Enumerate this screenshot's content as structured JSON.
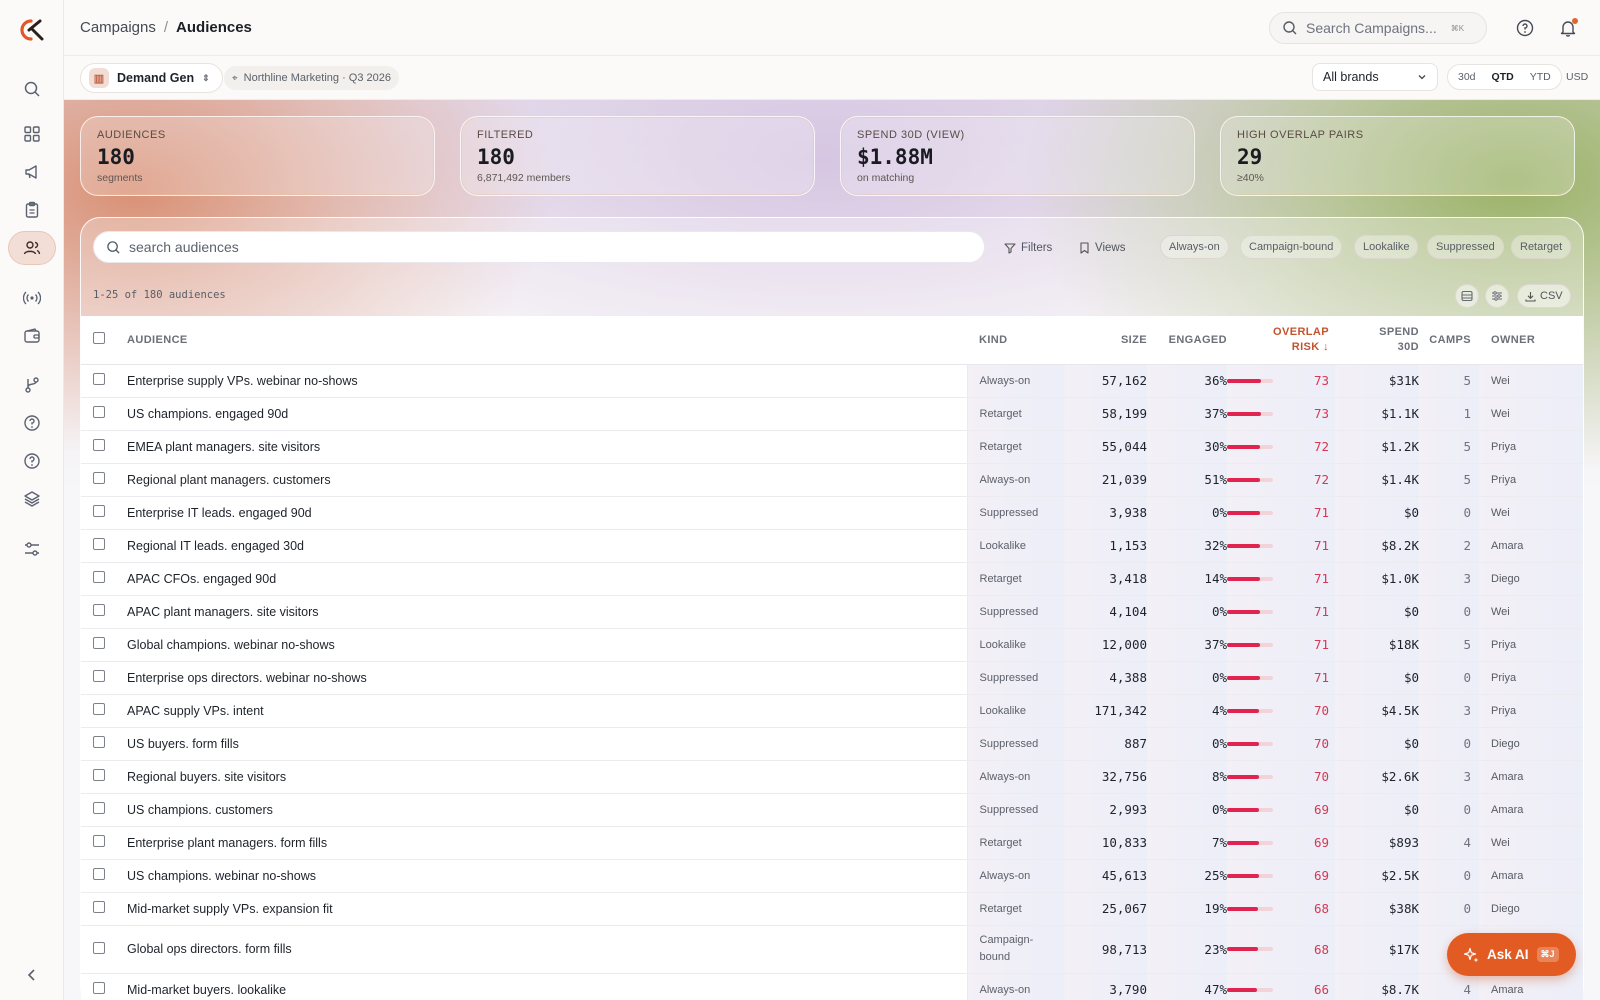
{
  "breadcrumb": {
    "parent": "Campaigns",
    "separator": "/",
    "current": "Audiences"
  },
  "top_search": {
    "placeholder": "Search Campaigns...",
    "shortcut": "⌘K"
  },
  "workspace": {
    "name": "Demand Gen",
    "context": "Northline Marketing · Q3 2026"
  },
  "brand_filter": {
    "value": "All brands"
  },
  "ranges": [
    "30d",
    "QTD",
    "YTD"
  ],
  "active_range": "QTD",
  "currency": "USD",
  "stats": [
    {
      "label": "Audiences",
      "value": "180",
      "sub": "segments"
    },
    {
      "label": "Filtered",
      "value": "180",
      "sub": "6,871,492 members"
    },
    {
      "label": "Spend 30D (view)",
      "value": "$1.88M",
      "sub": "on matching"
    },
    {
      "label": "High overlap pairs",
      "value": "29",
      "sub": "≥40%"
    }
  ],
  "table_search": {
    "placeholder": "search audiences"
  },
  "toolbar": {
    "filters": "Filters",
    "views": "Views",
    "csv": "CSV"
  },
  "kind_chips": [
    "Always-on",
    "Campaign-bound",
    "Lookalike",
    "Suppressed",
    "Retarget"
  ],
  "count_text": "1-25 of 180 audiences",
  "columns": {
    "audience": "Audience",
    "kind": "Kind",
    "size": "Size",
    "engaged": "Engaged",
    "overlap_risk_1": "Overlap",
    "overlap_risk_2": "Risk",
    "spend_1": "Spend",
    "spend_2": "30D",
    "camps": "Camps",
    "owner": "Owner"
  },
  "rows": [
    {
      "name": "Enterprise supply VPs. webinar no-shows",
      "kind": "Always-on",
      "size": "57,162",
      "engaged": "36%",
      "risk": 73,
      "spend": "$31K",
      "camps": "5",
      "owner": "Wei"
    },
    {
      "name": "US champions. engaged 90d",
      "kind": "Retarget",
      "size": "58,199",
      "engaged": "37%",
      "risk": 73,
      "spend": "$1.1K",
      "camps": "1",
      "owner": "Wei"
    },
    {
      "name": "EMEA plant managers. site visitors",
      "kind": "Retarget",
      "size": "55,044",
      "engaged": "30%",
      "risk": 72,
      "spend": "$1.2K",
      "camps": "5",
      "owner": "Priya"
    },
    {
      "name": "Regional plant managers. customers",
      "kind": "Always-on",
      "size": "21,039",
      "engaged": "51%",
      "risk": 72,
      "spend": "$1.4K",
      "camps": "5",
      "owner": "Priya"
    },
    {
      "name": "Enterprise IT leads. engaged 90d",
      "kind": "Suppressed",
      "size": "3,938",
      "engaged": "0%",
      "risk": 71,
      "spend": "$0",
      "camps": "0",
      "owner": "Wei"
    },
    {
      "name": "Regional IT leads. engaged 30d",
      "kind": "Lookalike",
      "size": "1,153",
      "engaged": "32%",
      "risk": 71,
      "spend": "$8.2K",
      "camps": "2",
      "owner": "Amara"
    },
    {
      "name": "APAC CFOs. engaged 90d",
      "kind": "Retarget",
      "size": "3,418",
      "engaged": "14%",
      "risk": 71,
      "spend": "$1.0K",
      "camps": "3",
      "owner": "Diego"
    },
    {
      "name": "APAC plant managers. site visitors",
      "kind": "Suppressed",
      "size": "4,104",
      "engaged": "0%",
      "risk": 71,
      "spend": "$0",
      "camps": "0",
      "owner": "Wei"
    },
    {
      "name": "Global champions. webinar no-shows",
      "kind": "Lookalike",
      "size": "12,000",
      "engaged": "37%",
      "risk": 71,
      "spend": "$18K",
      "camps": "5",
      "owner": "Priya"
    },
    {
      "name": "Enterprise ops directors. webinar no-shows",
      "kind": "Suppressed",
      "size": "4,388",
      "engaged": "0%",
      "risk": 71,
      "spend": "$0",
      "camps": "0",
      "owner": "Priya"
    },
    {
      "name": "APAC supply VPs. intent",
      "kind": "Lookalike",
      "size": "171,342",
      "engaged": "4%",
      "risk": 70,
      "spend": "$4.5K",
      "camps": "3",
      "owner": "Priya"
    },
    {
      "name": "US buyers. form fills",
      "kind": "Suppressed",
      "size": "887",
      "engaged": "0%",
      "risk": 70,
      "spend": "$0",
      "camps": "0",
      "owner": "Diego"
    },
    {
      "name": "Regional buyers. site visitors",
      "kind": "Always-on",
      "size": "32,756",
      "engaged": "8%",
      "risk": 70,
      "spend": "$2.6K",
      "camps": "3",
      "owner": "Amara"
    },
    {
      "name": "US champions. customers",
      "kind": "Suppressed",
      "size": "2,993",
      "engaged": "0%",
      "risk": 69,
      "spend": "$0",
      "camps": "0",
      "owner": "Amara"
    },
    {
      "name": "Enterprise plant managers. form fills",
      "kind": "Retarget",
      "size": "10,833",
      "engaged": "7%",
      "risk": 69,
      "spend": "$893",
      "camps": "4",
      "owner": "Wei"
    },
    {
      "name": "US champions. webinar no-shows",
      "kind": "Always-on",
      "size": "45,613",
      "engaged": "25%",
      "risk": 69,
      "spend": "$2.5K",
      "camps": "0",
      "owner": "Amara"
    },
    {
      "name": "Mid-market supply VPs. expansion fit",
      "kind": "Retarget",
      "size": "25,067",
      "engaged": "19%",
      "risk": 68,
      "spend": "$38K",
      "camps": "0",
      "owner": "Diego"
    },
    {
      "name": "Global ops directors. form fills",
      "kind": "Campaign-bound",
      "size": "98,713",
      "engaged": "23%",
      "risk": 68,
      "spend": "$17K",
      "camps": "",
      "owner": ""
    },
    {
      "name": "Mid-market buyers. lookalike",
      "kind": "Always-on",
      "size": "3,790",
      "engaged": "47%",
      "risk": 66,
      "spend": "$8.7K",
      "camps": "4",
      "owner": "Amara"
    }
  ],
  "ask_ai": {
    "label": "Ask AI",
    "shortcut": "⌘J"
  },
  "accent_color": "#e25b22",
  "risk_color": "#e0234f"
}
